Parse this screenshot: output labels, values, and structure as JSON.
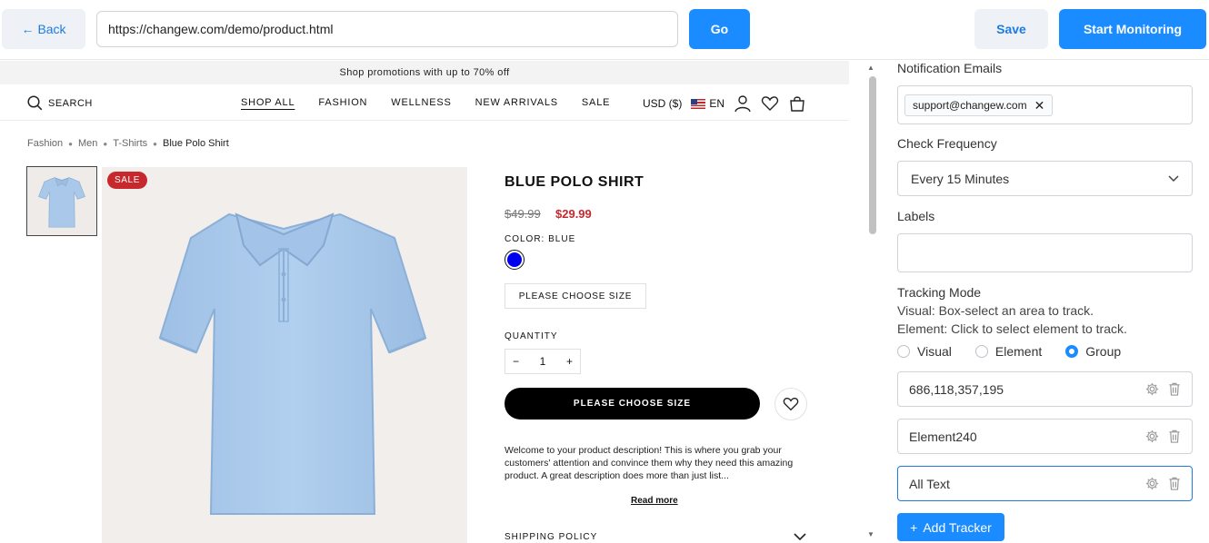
{
  "toolbar": {
    "back_label": "Back",
    "url_value": "https://changew.com/demo/product.html",
    "go_label": "Go",
    "save_label": "Save",
    "start_label": "Start Monitoring"
  },
  "store": {
    "promo": "Shop promotions with up to 70% off",
    "search_label": "SEARCH",
    "nav_links": [
      "SHOP ALL",
      "FASHION",
      "WELLNESS",
      "NEW ARRIVALS",
      "SALE"
    ],
    "currency": "USD ($)",
    "language": "EN",
    "breadcrumb": [
      "Fashion",
      "Men",
      "T-Shirts",
      "Blue Polo Shirt"
    ],
    "sale_badge": "SALE",
    "product": {
      "title": "BLUE POLO SHIRT",
      "old_price": "$49.99",
      "new_price": "$29.99",
      "color_label": "COLOR: BLUE",
      "swatch_color": "#0000f0",
      "size_button": "PLEASE CHOOSE SIZE",
      "quantity_label": "QUANTITY",
      "quantity_value": "1",
      "qty_minus": "−",
      "qty_plus": "+",
      "cta_label": "PLEASE CHOOSE SIZE",
      "description": "Welcome to your product description! This is where you grab your customers' attention and convince them why they need this amazing product. A great description does more than just list...",
      "read_more": "Read more",
      "shipping_label": "SHIPPING POLICY",
      "shirt_color": "#a9c8ea"
    }
  },
  "panel": {
    "notification_label": "Notification Emails",
    "email_chip": "support@changew.com",
    "frequency_label": "Check Frequency",
    "frequency_value": "Every 15 Minutes",
    "labels_label": "Labels",
    "labels_value": "",
    "mode_label": "Tracking Mode",
    "mode_help_visual": "Visual: Box-select an area to track.",
    "mode_help_element": "Element: Click to select element to track.",
    "modes": [
      "Visual",
      "Element",
      "Group"
    ],
    "selected_mode": "Group",
    "trackers": [
      "686,118,357,195",
      "Element240",
      "All Text"
    ],
    "add_tracker_label": "Add Tracker",
    "accent_color": "#1a8cff"
  }
}
